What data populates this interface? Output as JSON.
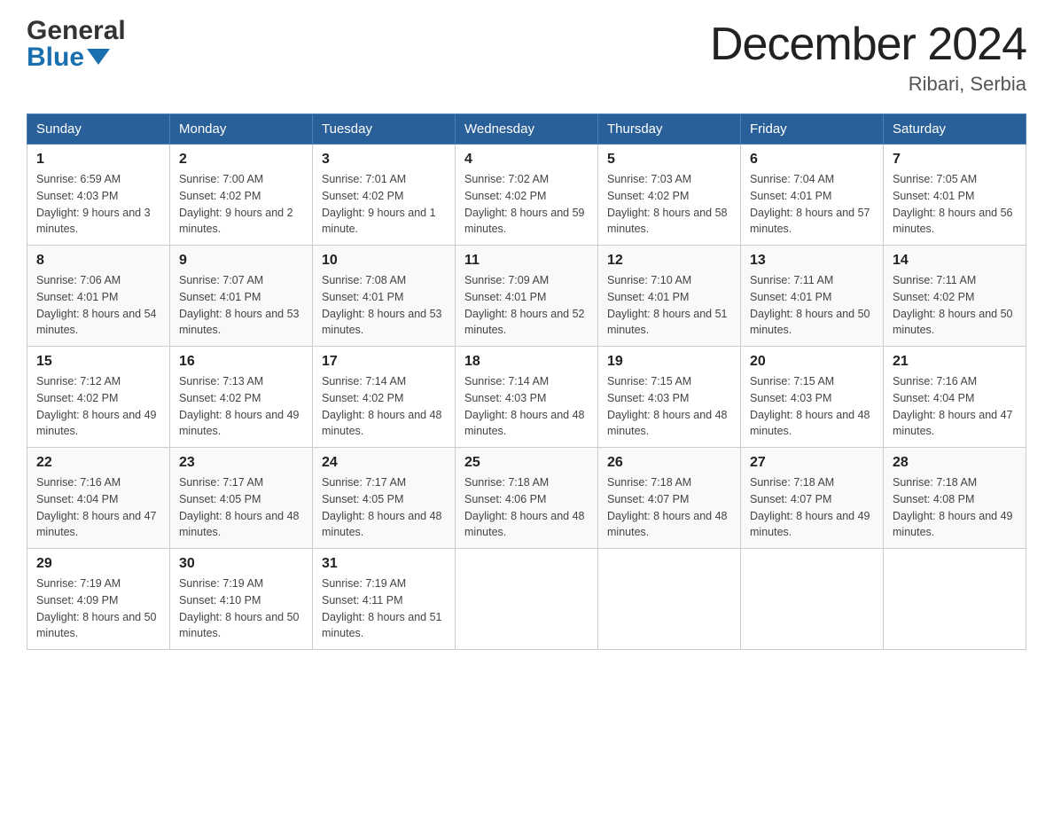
{
  "header": {
    "logo_line1": "General",
    "logo_line2": "Blue",
    "title": "December 2024",
    "location": "Ribari, Serbia"
  },
  "days_of_week": [
    "Sunday",
    "Monday",
    "Tuesday",
    "Wednesday",
    "Thursday",
    "Friday",
    "Saturday"
  ],
  "weeks": [
    [
      {
        "day": "1",
        "sunrise": "6:59 AM",
        "sunset": "4:03 PM",
        "daylight": "9 hours and 3 minutes."
      },
      {
        "day": "2",
        "sunrise": "7:00 AM",
        "sunset": "4:02 PM",
        "daylight": "9 hours and 2 minutes."
      },
      {
        "day": "3",
        "sunrise": "7:01 AM",
        "sunset": "4:02 PM",
        "daylight": "9 hours and 1 minute."
      },
      {
        "day": "4",
        "sunrise": "7:02 AM",
        "sunset": "4:02 PM",
        "daylight": "8 hours and 59 minutes."
      },
      {
        "day": "5",
        "sunrise": "7:03 AM",
        "sunset": "4:02 PM",
        "daylight": "8 hours and 58 minutes."
      },
      {
        "day": "6",
        "sunrise": "7:04 AM",
        "sunset": "4:01 PM",
        "daylight": "8 hours and 57 minutes."
      },
      {
        "day": "7",
        "sunrise": "7:05 AM",
        "sunset": "4:01 PM",
        "daylight": "8 hours and 56 minutes."
      }
    ],
    [
      {
        "day": "8",
        "sunrise": "7:06 AM",
        "sunset": "4:01 PM",
        "daylight": "8 hours and 54 minutes."
      },
      {
        "day": "9",
        "sunrise": "7:07 AM",
        "sunset": "4:01 PM",
        "daylight": "8 hours and 53 minutes."
      },
      {
        "day": "10",
        "sunrise": "7:08 AM",
        "sunset": "4:01 PM",
        "daylight": "8 hours and 53 minutes."
      },
      {
        "day": "11",
        "sunrise": "7:09 AM",
        "sunset": "4:01 PM",
        "daylight": "8 hours and 52 minutes."
      },
      {
        "day": "12",
        "sunrise": "7:10 AM",
        "sunset": "4:01 PM",
        "daylight": "8 hours and 51 minutes."
      },
      {
        "day": "13",
        "sunrise": "7:11 AM",
        "sunset": "4:01 PM",
        "daylight": "8 hours and 50 minutes."
      },
      {
        "day": "14",
        "sunrise": "7:11 AM",
        "sunset": "4:02 PM",
        "daylight": "8 hours and 50 minutes."
      }
    ],
    [
      {
        "day": "15",
        "sunrise": "7:12 AM",
        "sunset": "4:02 PM",
        "daylight": "8 hours and 49 minutes."
      },
      {
        "day": "16",
        "sunrise": "7:13 AM",
        "sunset": "4:02 PM",
        "daylight": "8 hours and 49 minutes."
      },
      {
        "day": "17",
        "sunrise": "7:14 AM",
        "sunset": "4:02 PM",
        "daylight": "8 hours and 48 minutes."
      },
      {
        "day": "18",
        "sunrise": "7:14 AM",
        "sunset": "4:03 PM",
        "daylight": "8 hours and 48 minutes."
      },
      {
        "day": "19",
        "sunrise": "7:15 AM",
        "sunset": "4:03 PM",
        "daylight": "8 hours and 48 minutes."
      },
      {
        "day": "20",
        "sunrise": "7:15 AM",
        "sunset": "4:03 PM",
        "daylight": "8 hours and 48 minutes."
      },
      {
        "day": "21",
        "sunrise": "7:16 AM",
        "sunset": "4:04 PM",
        "daylight": "8 hours and 47 minutes."
      }
    ],
    [
      {
        "day": "22",
        "sunrise": "7:16 AM",
        "sunset": "4:04 PM",
        "daylight": "8 hours and 47 minutes."
      },
      {
        "day": "23",
        "sunrise": "7:17 AM",
        "sunset": "4:05 PM",
        "daylight": "8 hours and 48 minutes."
      },
      {
        "day": "24",
        "sunrise": "7:17 AM",
        "sunset": "4:05 PM",
        "daylight": "8 hours and 48 minutes."
      },
      {
        "day": "25",
        "sunrise": "7:18 AM",
        "sunset": "4:06 PM",
        "daylight": "8 hours and 48 minutes."
      },
      {
        "day": "26",
        "sunrise": "7:18 AM",
        "sunset": "4:07 PM",
        "daylight": "8 hours and 48 minutes."
      },
      {
        "day": "27",
        "sunrise": "7:18 AM",
        "sunset": "4:07 PM",
        "daylight": "8 hours and 49 minutes."
      },
      {
        "day": "28",
        "sunrise": "7:18 AM",
        "sunset": "4:08 PM",
        "daylight": "8 hours and 49 minutes."
      }
    ],
    [
      {
        "day": "29",
        "sunrise": "7:19 AM",
        "sunset": "4:09 PM",
        "daylight": "8 hours and 50 minutes."
      },
      {
        "day": "30",
        "sunrise": "7:19 AM",
        "sunset": "4:10 PM",
        "daylight": "8 hours and 50 minutes."
      },
      {
        "day": "31",
        "sunrise": "7:19 AM",
        "sunset": "4:11 PM",
        "daylight": "8 hours and 51 minutes."
      },
      null,
      null,
      null,
      null
    ]
  ],
  "labels": {
    "sunrise": "Sunrise: ",
    "sunset": "Sunset: ",
    "daylight": "Daylight: "
  }
}
